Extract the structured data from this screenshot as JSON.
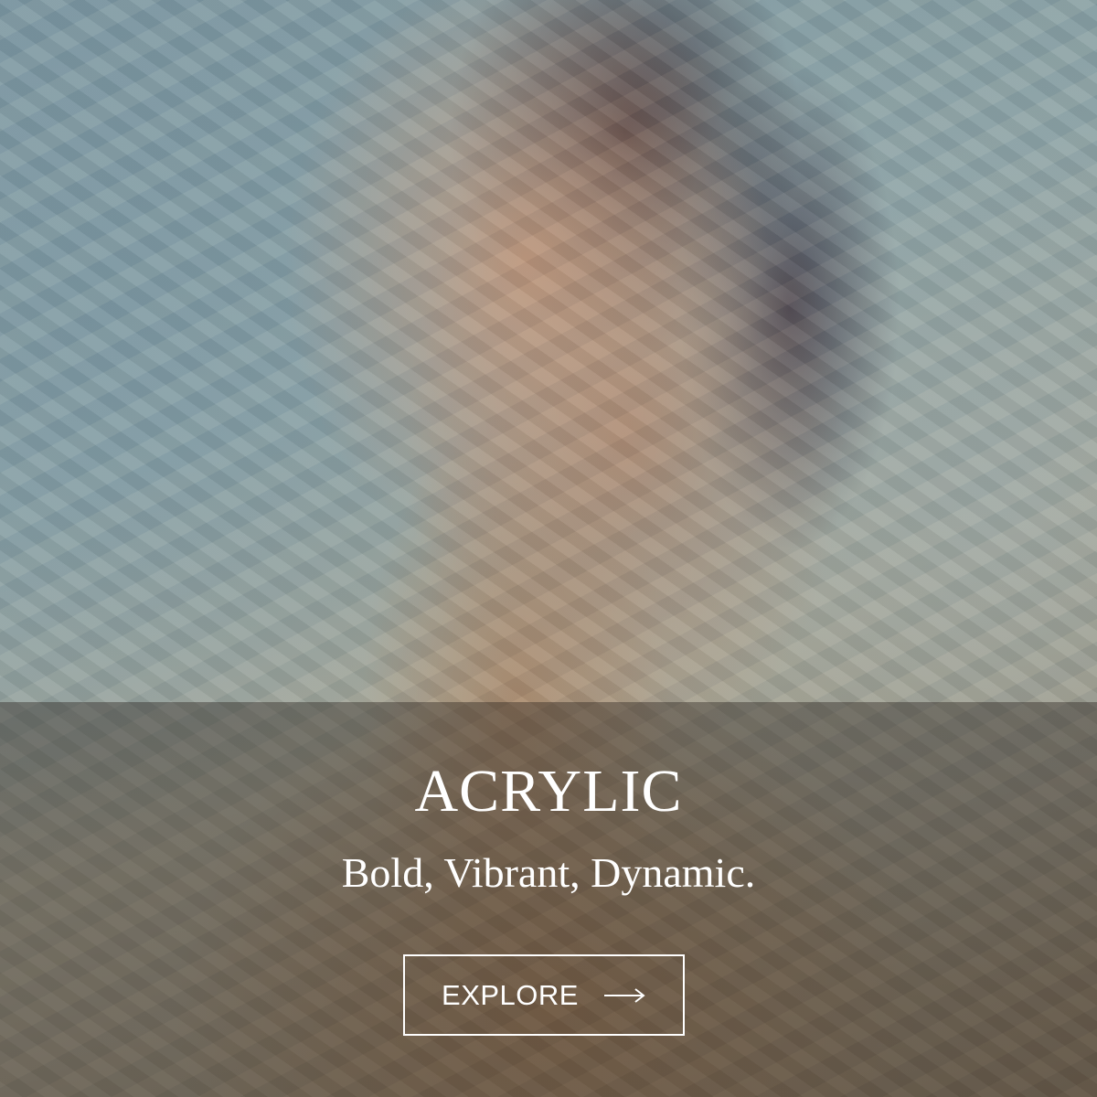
{
  "hero": {
    "title": "ACRYLIC",
    "subtitle": "Bold, Vibrant, Dynamic.",
    "image_icon": "acrylic-portrait-painting"
  },
  "cta": {
    "label": "EXPLORE",
    "icon": "arrow-right-icon"
  },
  "colors": {
    "text": "#ffffff",
    "overlay": "rgba(40,32,28,0.40)"
  }
}
